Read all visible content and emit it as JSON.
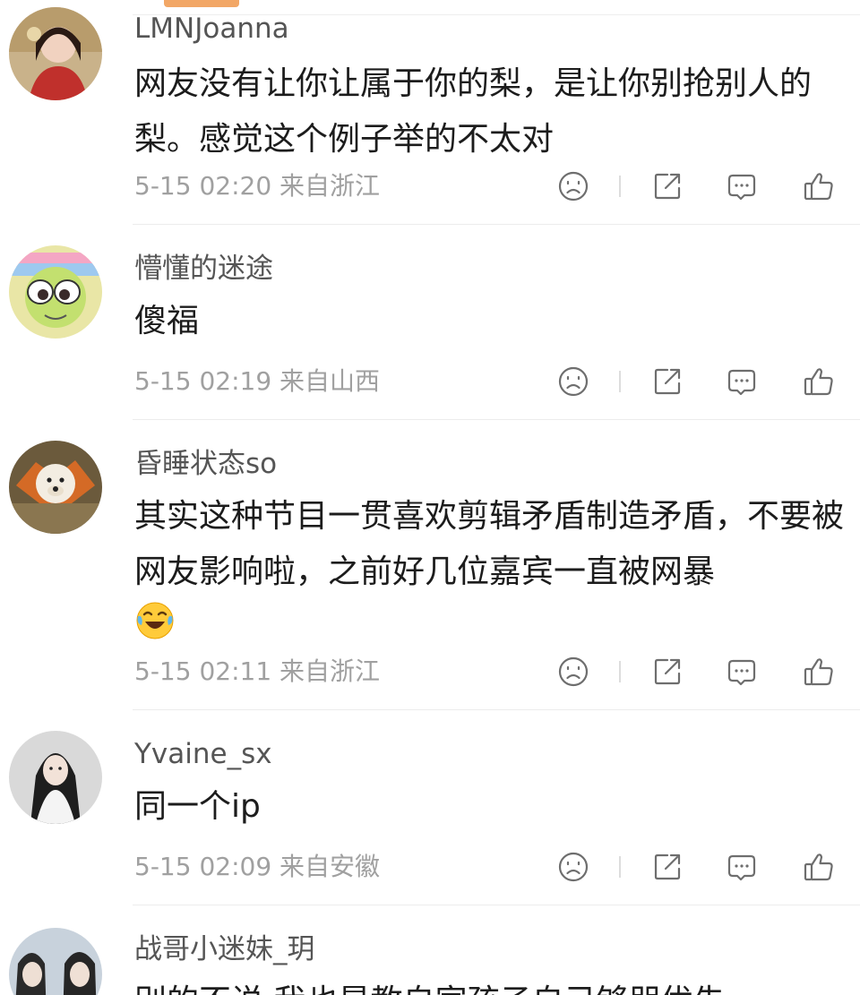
{
  "comments": [
    {
      "username": "LMNJoanna",
      "text": "网友没有让你让属于你的梨，是让你别抢别人的梨。感觉这个例子举的不太对",
      "time": "5-15 02:20",
      "location": "来自浙江"
    },
    {
      "username": "懵懂的迷途",
      "text": "傻福",
      "time": "5-15 02:19",
      "location": "来自山西"
    },
    {
      "username": "昏睡状态so",
      "text": "其实这种节目一贯喜欢剪辑矛盾制造矛盾，不要被网友影响啦，之前好几位嘉宾一直被网暴",
      "time": "5-15 02:11",
      "location": "来自浙江"
    },
    {
      "username": "Yvaine_sx",
      "text": "同一个ip",
      "time": "5-15 02:09",
      "location": "来自安徽"
    },
    {
      "username": "战哥小迷妹_玥",
      "text": "别的不说 我也是教自家孩子自己够朋优先",
      "time": "",
      "location": ""
    }
  ],
  "icons": {
    "dislike": "sad-face-icon",
    "share": "share-icon",
    "reply": "comment-icon",
    "like": "thumbs-up-icon",
    "emoji": "laughing-tears-emoji"
  },
  "colors": {
    "tab_indicator": "#f2a766",
    "meta_text": "#a0a0a0",
    "icon_stroke": "#6e6e6e"
  }
}
